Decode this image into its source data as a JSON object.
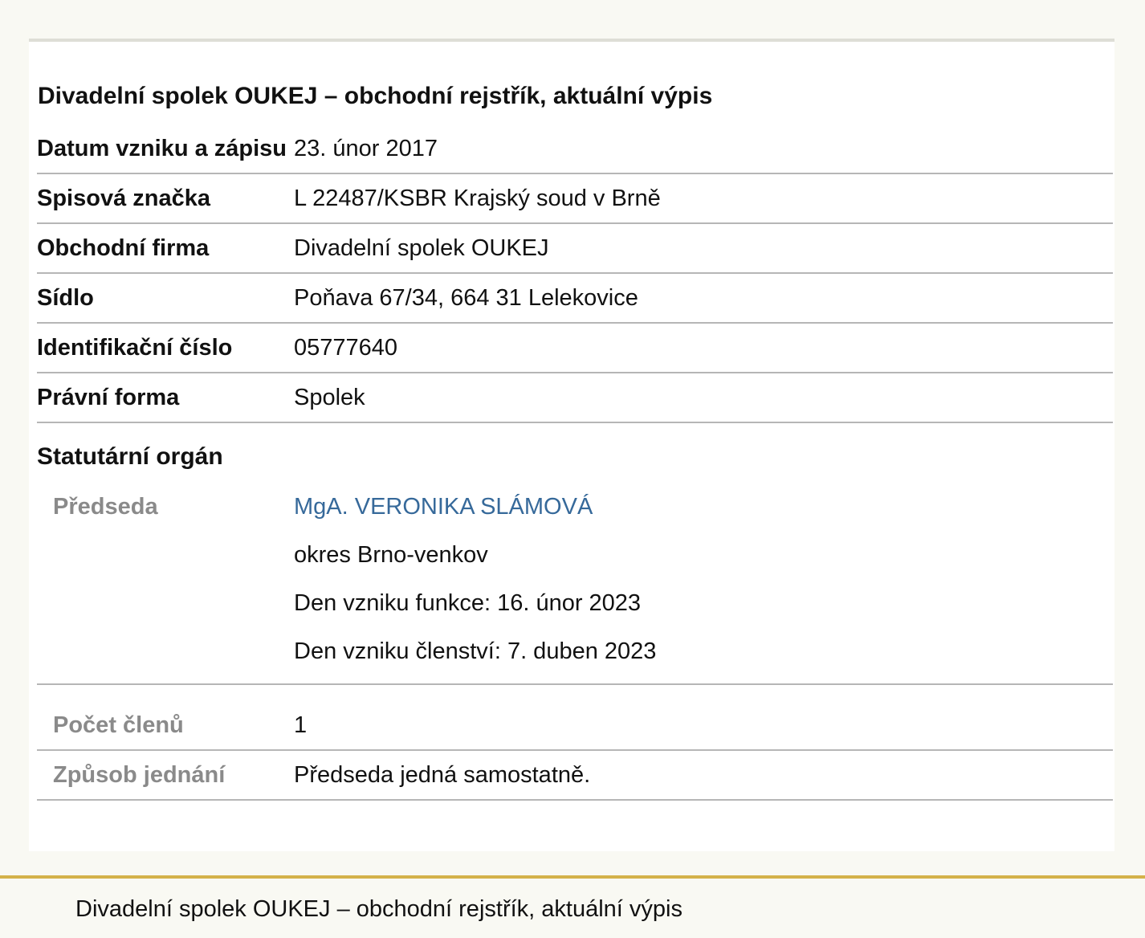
{
  "title": "Divadelní spolek OUKEJ – obchodní rejstřík, aktuální výpis",
  "rows": [
    {
      "label": "Datum vzniku a zápisu",
      "value": "23. únor 2017"
    },
    {
      "label": "Spisová značka",
      "value": "L 22487/KSBR Krajský soud v Brně"
    },
    {
      "label": "Obchodní firma",
      "value": "Divadelní spolek OUKEJ"
    },
    {
      "label": "Sídlo",
      "value": "Poňava 67/34, 664 31 Lelekovice"
    },
    {
      "label": "Identifikační číslo",
      "value": "05777640"
    },
    {
      "label": "Právní forma",
      "value": "Spolek"
    }
  ],
  "statutory": {
    "heading": "Statutární orgán",
    "chair_label": "Předseda",
    "chair_name": "MgA. VERONIKA SLÁMOVÁ",
    "chair_district": "okres Brno-venkov",
    "chair_function_start": "Den vzniku funkce: 16. únor 2023",
    "chair_membership_start": "Den vzniku členství: 7. duben 2023",
    "members_label": "Počet členů",
    "members_value": "1",
    "acting_label": "Způsob jednání",
    "acting_value": "Předseda jedná samostatně."
  },
  "footer": {
    "text": "Divadelní spolek OUKEJ – obchodní rejstřík, aktuální výpis"
  },
  "colors": {
    "link": "#36699a",
    "footer_border": "#d4b24a",
    "sub_label": "#8a8a8a"
  }
}
